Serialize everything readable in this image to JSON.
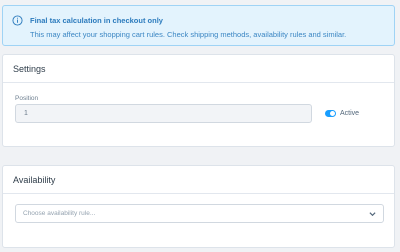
{
  "alert": {
    "title": "Final tax calculation in checkout only",
    "message": "This may affect your shopping cart rules. Check shipping methods, availability rules and similar.",
    "icon": "info-icon"
  },
  "settings": {
    "title": "Settings",
    "position_label": "Position",
    "position_value": "1",
    "active_label": "Active",
    "active_enabled": true
  },
  "availability": {
    "title": "Availability",
    "placeholder": "Choose availability rule..."
  },
  "colors": {
    "accent": "#189eff",
    "alert_background": "#e3f3fd",
    "alert_text": "#2c7bbd"
  }
}
